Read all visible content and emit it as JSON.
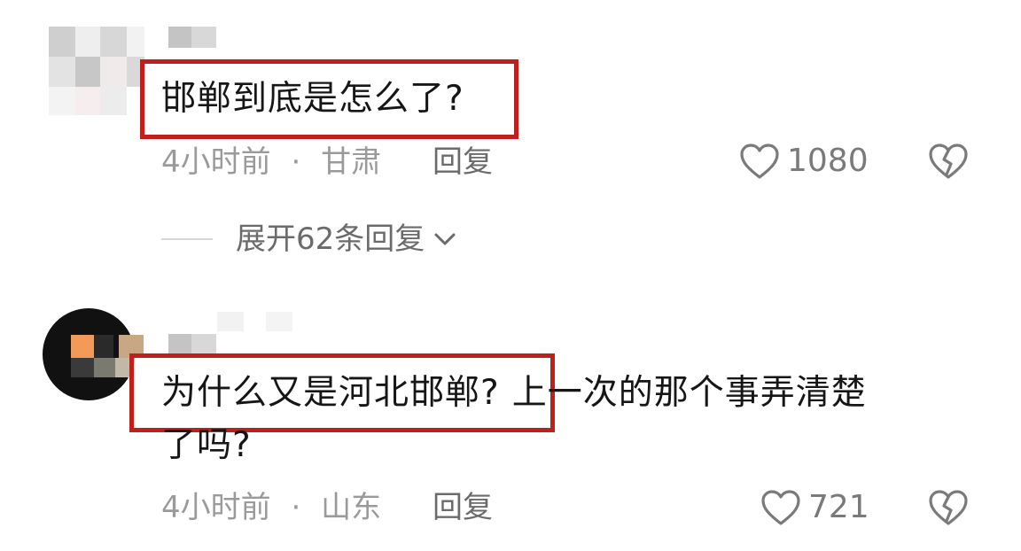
{
  "comments": [
    {
      "text": "邯郸到底是怎么了?",
      "highlighted_text": "邯郸到底是怎么了?",
      "time": "4小时前",
      "separator": "·",
      "location": "甘肃",
      "reply_label": "回复",
      "likes": "1080",
      "expand_replies_label": "展开62条回复"
    },
    {
      "text_line1_highlighted": "为什么又是河北邯郸?",
      "text_line1_rest": "上一次的那个事弄清楚",
      "text_line2": "了吗?",
      "time": "4小时前",
      "separator": "·",
      "location": "山东",
      "reply_label": "回复",
      "likes": "721"
    }
  ],
  "colors": {
    "highlight_border": "#c0201c",
    "meta_text": "#9a9a9a",
    "icon_stroke": "#7a7a7a"
  },
  "icons": [
    "heart-outline-icon",
    "broken-heart-icon",
    "chevron-down-icon"
  ]
}
